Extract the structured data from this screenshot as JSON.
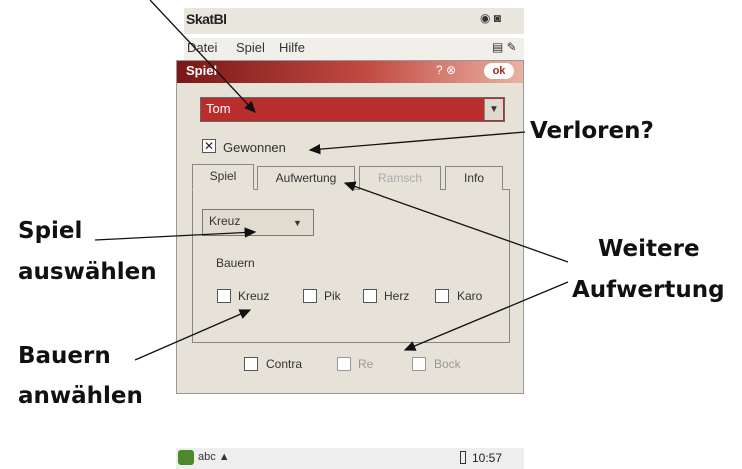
{
  "device": {
    "app_title": "SkatBl",
    "top_icons": "◉ ◙",
    "menu": [
      "Datei",
      "Spiel",
      "Hilfe"
    ],
    "menu_icons": "▤ ✎"
  },
  "dialog": {
    "title": "Spiel",
    "controls": "? ⊗",
    "ok_label": "ok",
    "player_value": "Tom",
    "won_label": "Gewonnen",
    "tabs": [
      "Spiel",
      "Aufwertung",
      "Ramsch",
      "Info"
    ],
    "game_value": "Kreuz",
    "bauern_label": "Bauern",
    "bauern": [
      "Kreuz",
      "Pik",
      "Herz",
      "Karo"
    ],
    "bottom": [
      "Contra",
      "Re",
      "Bock"
    ]
  },
  "taskbar": {
    "icons": "abc ▲",
    "clock": "10:57"
  },
  "annotations": {
    "verloren": "Verloren?",
    "spiel_line1": "Spiel",
    "spiel_line2": "auswählen",
    "weitere_line1": "Weitere",
    "weitere_line2": "Aufwertung",
    "bauern_line1": "Bauern",
    "bauern_line2": "anwählen"
  },
  "colors": {
    "titlebar": "#7a1716",
    "combo_red": "#b92d2d",
    "dialog_bg": "#e6e2d7"
  }
}
